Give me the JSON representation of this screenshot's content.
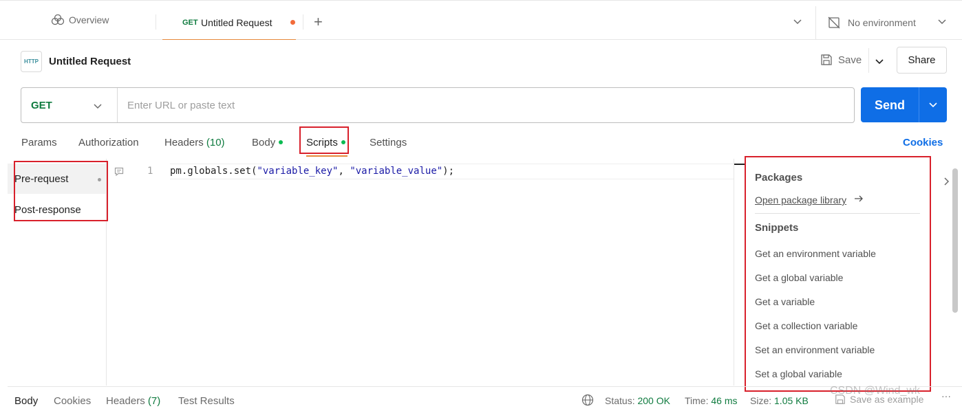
{
  "tabs": {
    "overview_label": "Overview",
    "active_method": "GET",
    "active_name": "Untitled Request"
  },
  "environment": {
    "label": "No environment"
  },
  "request": {
    "title": "Untitled Request",
    "http_icon_text": "HTTP",
    "save_label": "Save",
    "share_label": "Share",
    "method": "GET",
    "url_placeholder": "Enter URL or paste text",
    "send_label": "Send"
  },
  "request_tabs": {
    "params": "Params",
    "authorization": "Authorization",
    "headers": "Headers",
    "headers_count": "(10)",
    "body": "Body",
    "scripts": "Scripts",
    "settings": "Settings",
    "cookies": "Cookies"
  },
  "script_sidebar": {
    "pre_request": "Pre-request",
    "post_response": "Post-response"
  },
  "editor": {
    "line_number": "1",
    "code_prefix": "pm.globals.set(",
    "code_arg1": "\"variable_key\"",
    "code_sep": ", ",
    "code_arg2": "\"variable_value\"",
    "code_suffix": ");"
  },
  "snippets_panel": {
    "packages_title": "Packages",
    "open_package_library": "Open package library",
    "snippets_title": "Snippets",
    "items": [
      "Get an environment variable",
      "Get a global variable",
      "Get a variable",
      "Get a collection variable",
      "Set an environment variable",
      "Set a global variable"
    ]
  },
  "response_bar": {
    "body": "Body",
    "cookies": "Cookies",
    "headers": "Headers",
    "headers_count": "(7)",
    "test_results": "Test Results",
    "status_label": "Status:",
    "status_value": "200 OK",
    "time_label": "Time:",
    "time_value": "46 ms",
    "size_label": "Size:",
    "size_value": "1.05 KB",
    "save_as_example": "Save as example",
    "more": "···"
  },
  "watermark": "CSDN @Wind_wk",
  "colors": {
    "accent_blue": "#0f6ee6",
    "method_green": "#0f7b3f",
    "tab_orange": "#e6883a",
    "highlight_red": "#d8202b"
  }
}
